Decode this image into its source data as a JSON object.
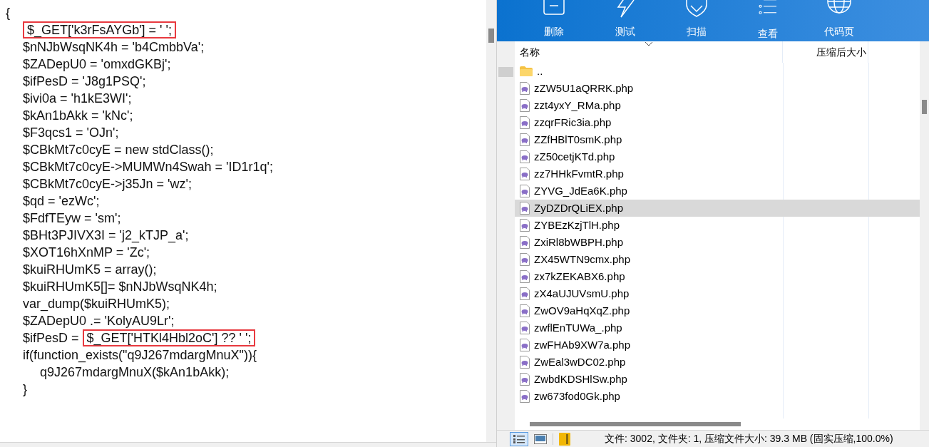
{
  "code_editor": {
    "lines": [
      {
        "text": "{",
        "children": [
          {
            "parts": [
              {
                "text": "$_GET['k3rFsAYGb'] = ' ';",
                "boxed": true
              }
            ]
          },
          {
            "text": "$nNJbWsqNK4h = 'b4CmbbVa';"
          },
          {
            "text": "$ZADepU0 = 'omxdGKBj';"
          },
          {
            "text": "$ifPesD = 'J8g1PSQ';"
          },
          {
            "text": "$ivi0a = 'h1kE3WI';"
          },
          {
            "text": "$kAn1bAkk = 'kNc';"
          },
          {
            "text": "$F3qcs1 = 'OJn';"
          },
          {
            "text": "$CBkMt7c0cyE = new stdClass();"
          },
          {
            "text": "$CBkMt7c0cyE->MUMWn4Swah = 'ID1r1q';"
          },
          {
            "text": "$CBkMt7c0cyE->j35Jn = 'wz';"
          },
          {
            "text": "$qd = 'ezWc';"
          },
          {
            "text": "$FdfTEyw = 'sm';"
          },
          {
            "text": "$BHt3PJIVX3I = 'j2_kTJP_a';"
          },
          {
            "text": "$XOT16hXnMP = 'Zc';"
          },
          {
            "text": "$kuiRHUmK5 = array();"
          },
          {
            "text": "$kuiRHUmK5[]= $nNJbWsqNK4h;"
          },
          {
            "text": "var_dump($kuiRHUmK5);"
          },
          {
            "text": "$ZADepU0 .= 'KolyAU9Lr';"
          },
          {
            "parts": [
              {
                "text": "$ifPesD = ",
                "boxed": false
              },
              {
                "text": "$_GET['HTKl4Hbl2oC'] ?? ' ';",
                "boxed": true
              }
            ]
          },
          {
            "text": "if(function_exists(\"q9J267mdargMnuX\")){",
            "children": [
              {
                "text": "q9J267mdargMnuX($kAn1bAkk);"
              }
            ]
          },
          {
            "text": "}"
          }
        ]
      }
    ]
  },
  "archive": {
    "toolbar": [
      {
        "label": "删除",
        "kind": "delete"
      },
      {
        "label": "测试",
        "kind": "test"
      },
      {
        "label": "扫描",
        "kind": "scan"
      },
      {
        "label": "查看",
        "kind": "view"
      },
      {
        "label": "代码页",
        "kind": "codepage"
      }
    ],
    "columns": [
      "名称",
      "压缩后大小"
    ],
    "files": [
      {
        "name": "..",
        "kind": "folder",
        "selected": false
      },
      {
        "name": "zZW5U1aQRRK.php",
        "kind": "php",
        "selected": false
      },
      {
        "name": "zzt4yxY_RMa.php",
        "kind": "php",
        "selected": false
      },
      {
        "name": "zzqrFRic3ia.php",
        "kind": "php",
        "selected": false
      },
      {
        "name": "ZZfHBlT0smK.php",
        "kind": "php",
        "selected": false
      },
      {
        "name": "zZ50cetjKTd.php",
        "kind": "php",
        "selected": false
      },
      {
        "name": "zz7HHkFvmtR.php",
        "kind": "php",
        "selected": false
      },
      {
        "name": "ZYVG_JdEa6K.php",
        "kind": "php",
        "selected": false
      },
      {
        "name": "ZyDZDrQLiEX.php",
        "kind": "php",
        "selected": true
      },
      {
        "name": "ZYBEzKzjTlH.php",
        "kind": "php",
        "selected": false
      },
      {
        "name": "ZxiRl8bWBPH.php",
        "kind": "php",
        "selected": false
      },
      {
        "name": "ZX45WTN9cmx.php",
        "kind": "php",
        "selected": false
      },
      {
        "name": "zx7kZEKABX6.php",
        "kind": "php",
        "selected": false
      },
      {
        "name": "zX4aUJUVsmU.php",
        "kind": "php",
        "selected": false
      },
      {
        "name": "ZwOV9aHqXqZ.php",
        "kind": "php",
        "selected": false
      },
      {
        "name": "zwflEnTUWa_.php",
        "kind": "php",
        "selected": false
      },
      {
        "name": "zwFHAb9XW7a.php",
        "kind": "php",
        "selected": false
      },
      {
        "name": "ZwEal3wDC02.php",
        "kind": "php",
        "selected": false
      },
      {
        "name": "ZwbdKDSHlSw.php",
        "kind": "php",
        "selected": false
      },
      {
        "name": "zw673fod0Gk.php",
        "kind": "php",
        "selected": false
      }
    ],
    "status_bar": "文件: 3002, 文件夹: 1, 压缩文件大小: 39.3 MB (固实压缩,100.0%)"
  }
}
